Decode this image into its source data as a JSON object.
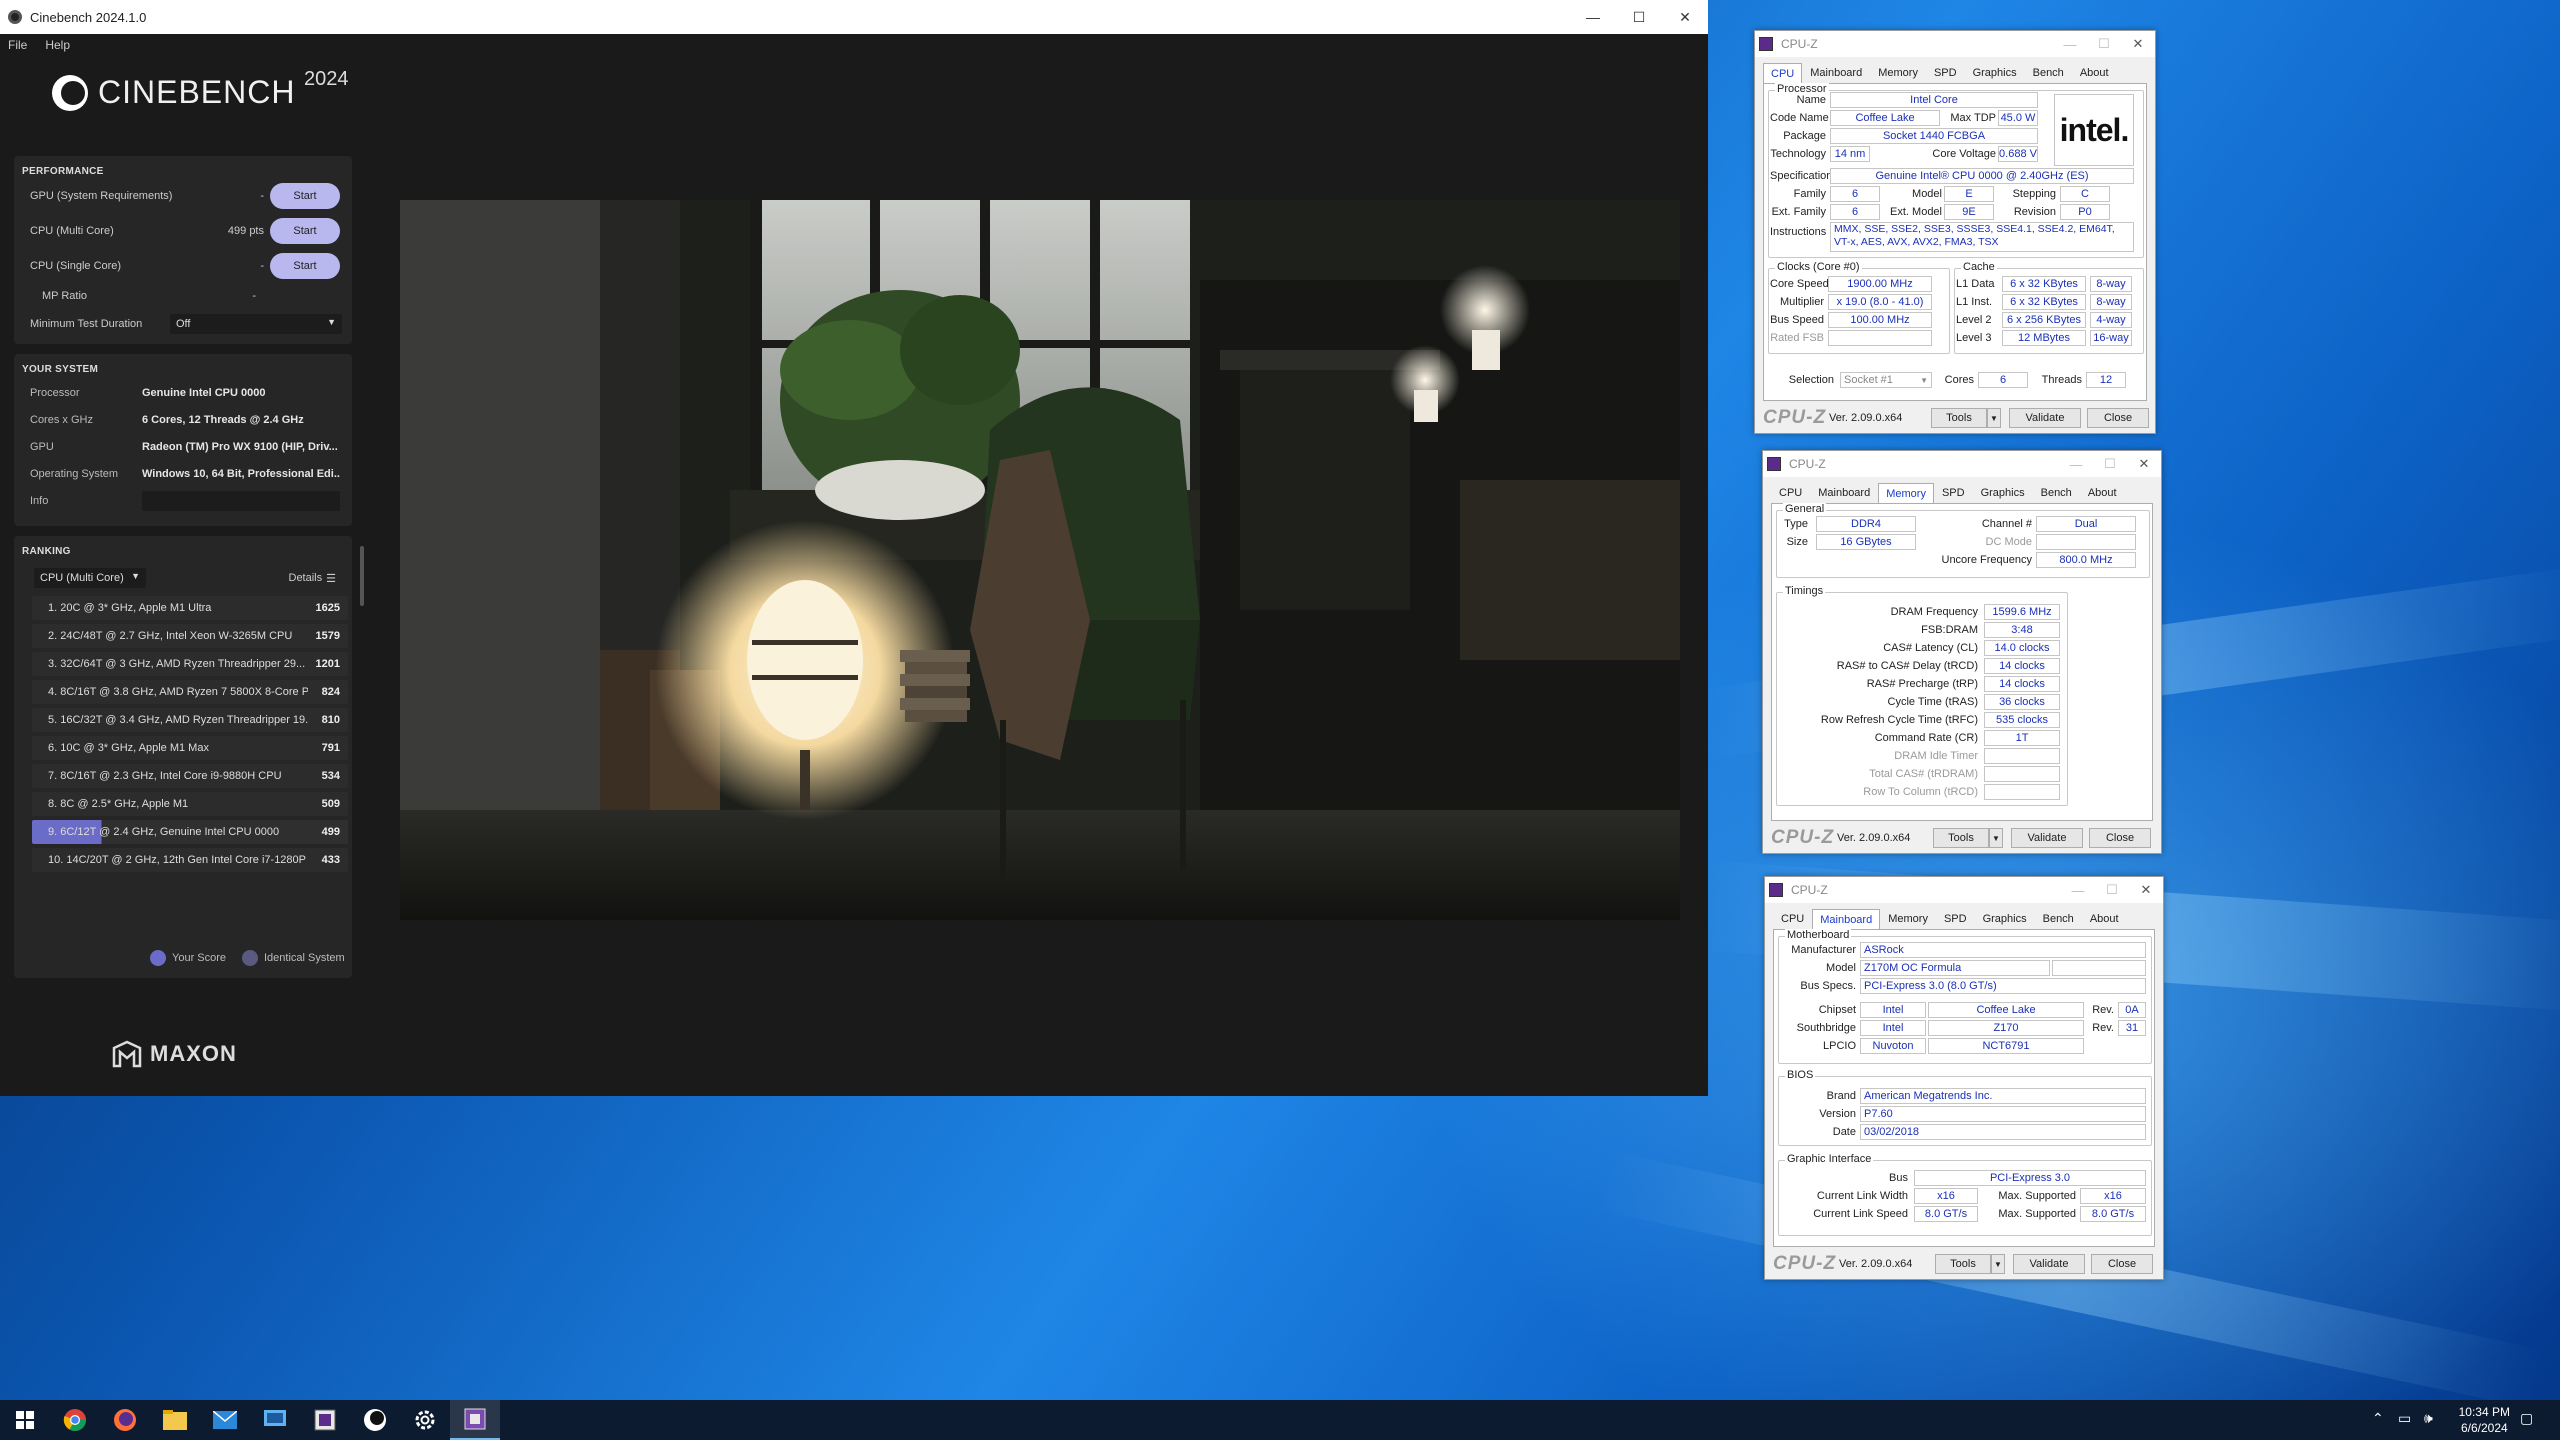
{
  "cinebench": {
    "window_title": "Cinebench 2024.1.0",
    "menu": [
      "File",
      "Help"
    ],
    "brand": "CINEBENCH",
    "year": "2024",
    "performance": {
      "header": "PERFORMANCE",
      "rows": [
        {
          "label": "GPU (System Requirements)",
          "points": "-",
          "button": "Start"
        },
        {
          "label": "CPU (Multi Core)",
          "points": "499 pts",
          "button": "Start"
        },
        {
          "label": "CPU (Single Core)",
          "points": "-",
          "button": "Start"
        }
      ],
      "mp_ratio_label": "MP Ratio",
      "mp_ratio_value": "-",
      "min_test_label": "Minimum Test Duration",
      "min_test_value": "Off"
    },
    "system": {
      "header": "YOUR SYSTEM",
      "rows": [
        {
          "key": "Processor",
          "value": "Genuine Intel CPU 0000"
        },
        {
          "key": "Cores x GHz",
          "value": "6 Cores, 12 Threads @ 2.4 GHz"
        },
        {
          "key": "GPU",
          "value": "Radeon (TM) Pro WX 9100 (HIP, Driv..."
        },
        {
          "key": "Operating System",
          "value": "Windows 10, 64 Bit, Professional Edi..."
        },
        {
          "key": "Info",
          "value": ""
        }
      ]
    },
    "ranking": {
      "header": "RANKING",
      "selector": "CPU (Multi Core)",
      "details": "Details",
      "rows": [
        {
          "name": "1. 20C @ 3* GHz, Apple M1 Ultra",
          "score": "1625",
          "mine": false
        },
        {
          "name": "2. 24C/48T @ 2.7 GHz, Intel Xeon W-3265M CPU",
          "score": "1579",
          "mine": false
        },
        {
          "name": "3. 32C/64T @ 3 GHz, AMD Ryzen Threadripper 29...",
          "score": "1201",
          "mine": false
        },
        {
          "name": "4. 8C/16T @ 3.8 GHz, AMD Ryzen 7 5800X 8-Core P...",
          "score": "824",
          "mine": false
        },
        {
          "name": "5. 16C/32T @ 3.4 GHz, AMD Ryzen Threadripper 19...",
          "score": "810",
          "mine": false
        },
        {
          "name": "6. 10C @ 3* GHz, Apple M1 Max",
          "score": "791",
          "mine": false
        },
        {
          "name": "7. 8C/16T @ 2.3 GHz, Intel Core i9-9880H CPU",
          "score": "534",
          "mine": false
        },
        {
          "name": "8. 8C @ 2.5* GHz, Apple M1",
          "score": "509",
          "mine": false
        },
        {
          "name": "9. 6C/12T @ 2.4 GHz, Genuine Intel CPU 0000",
          "score": "499",
          "mine": true
        },
        {
          "name": "10. 14C/20T @ 2 GHz, 12th Gen Intel Core i7-1280P",
          "score": "433",
          "mine": false
        }
      ],
      "legend_your": "Your Score",
      "legend_identical": "Identical System"
    },
    "maxon": "MAXON",
    "colors": {
      "accent": "#b8b8ef",
      "your_score": "#6b6bc8",
      "identical": "#5a5a80"
    }
  },
  "cpuz_cpu": {
    "title": "CPU-Z",
    "tabs": [
      "CPU",
      "Mainboard",
      "Memory",
      "SPD",
      "Graphics",
      "Bench",
      "About"
    ],
    "active_tab": "CPU",
    "processor_group": "Processor",
    "name_label": "Name",
    "name": "Intel Core",
    "code_name_label": "Code Name",
    "code_name": "Coffee Lake",
    "max_tdp_label": "Max TDP",
    "max_tdp": "45.0 W",
    "package_label": "Package",
    "package": "Socket 1440 FCBGA",
    "technology_label": "Technology",
    "technology": "14 nm",
    "core_voltage_label": "Core Voltage",
    "core_voltage": "0.688 V",
    "specification_label": "Specification",
    "specification": "Genuine Intel® CPU 0000 @ 2.40GHz (ES)",
    "family_label": "Family",
    "family": "6",
    "model_label": "Model",
    "model": "E",
    "stepping_label": "Stepping",
    "stepping": "C",
    "ext_family_label": "Ext. Family",
    "ext_family": "6",
    "ext_model_label": "Ext. Model",
    "ext_model": "9E",
    "revision_label": "Revision",
    "revision": "P0",
    "instructions_label": "Instructions",
    "instructions": "MMX, SSE, SSE2, SSE3, SSSE3, SSE4.1, SSE4.2, EM64T, VT-x, AES, AVX, AVX2, FMA3, TSX",
    "logo": "intel.",
    "clocks_group": "Clocks (Core #0)",
    "core_speed_label": "Core Speed",
    "core_speed": "1900.00 MHz",
    "multiplier_label": "Multiplier",
    "multiplier": "x 19.0 (8.0 - 41.0)",
    "bus_speed_label": "Bus Speed",
    "bus_speed": "100.00 MHz",
    "rated_fsb_label": "Rated FSB",
    "rated_fsb": "",
    "cache_group": "Cache",
    "cache": [
      {
        "label": "L1 Data",
        "size": "6 x 32 KBytes",
        "way": "8-way"
      },
      {
        "label": "L1 Inst.",
        "size": "6 x 32 KBytes",
        "way": "8-way"
      },
      {
        "label": "Level 2",
        "size": "6 x 256 KBytes",
        "way": "4-way"
      },
      {
        "label": "Level 3",
        "size": "12 MBytes",
        "way": "16-way"
      }
    ],
    "selection_label": "Selection",
    "selection": "Socket #1",
    "cores_label": "Cores",
    "cores": "6",
    "threads_label": "Threads",
    "threads": "12",
    "brand": "CPU-Z",
    "version": "Ver. 2.09.0.x64",
    "tools": "Tools",
    "validate": "Validate",
    "close": "Close"
  },
  "cpuz_mem": {
    "title": "CPU-Z",
    "tabs": [
      "CPU",
      "Mainboard",
      "Memory",
      "SPD",
      "Graphics",
      "Bench",
      "About"
    ],
    "active_tab": "Memory",
    "general_group": "General",
    "type_label": "Type",
    "type": "DDR4",
    "size_label": "Size",
    "size": "16 GBytes",
    "channel_label": "Channel #",
    "channel": "Dual",
    "dc_mode_label": "DC Mode",
    "dc_mode": "",
    "uncore_label": "Uncore Frequency",
    "uncore": "800.0 MHz",
    "timings_group": "Timings",
    "timings": [
      {
        "label": "DRAM Frequency",
        "value": "1599.6 MHz",
        "dim": false
      },
      {
        "label": "FSB:DRAM",
        "value": "3:48",
        "dim": false
      },
      {
        "label": "CAS# Latency (CL)",
        "value": "14.0 clocks",
        "dim": false
      },
      {
        "label": "RAS# to CAS# Delay (tRCD)",
        "value": "14 clocks",
        "dim": false
      },
      {
        "label": "RAS# Precharge (tRP)",
        "value": "14 clocks",
        "dim": false
      },
      {
        "label": "Cycle Time (tRAS)",
        "value": "36 clocks",
        "dim": false
      },
      {
        "label": "Row Refresh Cycle Time (tRFC)",
        "value": "535 clocks",
        "dim": false
      },
      {
        "label": "Command Rate (CR)",
        "value": "1T",
        "dim": false
      },
      {
        "label": "DRAM Idle Timer",
        "value": "",
        "dim": true
      },
      {
        "label": "Total CAS# (tRDRAM)",
        "value": "",
        "dim": true
      },
      {
        "label": "Row To Column (tRCD)",
        "value": "",
        "dim": true
      }
    ],
    "brand": "CPU-Z",
    "version": "Ver. 2.09.0.x64",
    "tools": "Tools",
    "validate": "Validate",
    "close": "Close"
  },
  "cpuz_mb": {
    "title": "CPU-Z",
    "tabs": [
      "CPU",
      "Mainboard",
      "Memory",
      "SPD",
      "Graphics",
      "Bench",
      "About"
    ],
    "active_tab": "Mainboard",
    "motherboard_group": "Motherboard",
    "manufacturer_label": "Manufacturer",
    "manufacturer": "ASRock",
    "model_label": "Model",
    "model": "Z170M OC Formula",
    "bus_specs_label": "Bus Specs.",
    "bus_specs": "PCI-Express 3.0 (8.0 GT/s)",
    "chipset_label": "Chipset",
    "chipset_vendor": "Intel",
    "chipset_name": "Coffee Lake",
    "chipset_rev_label": "Rev.",
    "chipset_rev": "0A",
    "southbridge_label": "Southbridge",
    "southbridge_vendor": "Intel",
    "southbridge_name": "Z170",
    "southbridge_rev_label": "Rev.",
    "southbridge_rev": "31",
    "lpcio_label": "LPCIO",
    "lpcio_vendor": "Nuvoton",
    "lpcio_name": "NCT6791",
    "bios_group": "BIOS",
    "brand_label": "Brand",
    "bios_brand": "American Megatrends Inc.",
    "version_label": "Version",
    "bios_version": "P7.60",
    "date_label": "Date",
    "bios_date": "03/02/2018",
    "graphic_group": "Graphic Interface",
    "bus_label": "Bus",
    "bus": "PCI-Express 3.0",
    "link_width_label": "Current Link Width",
    "link_width": "x16",
    "max_width_label": "Max. Supported",
    "max_width": "x16",
    "link_speed_label": "Current Link Speed",
    "link_speed": "8.0 GT/s",
    "max_speed_label": "Max. Supported",
    "max_speed": "8.0 GT/s",
    "brand": "CPU-Z",
    "version": "Ver. 2.09.0.x64",
    "tools": "Tools",
    "validate": "Validate",
    "close": "Close"
  },
  "taskbar": {
    "time": "10:34 PM",
    "date": "6/6/2024",
    "apps": [
      "windows-start-icon",
      "chrome-icon",
      "firefox-icon",
      "file-explorer-icon",
      "mail-icon",
      "app-icon",
      "cpu-z-taskbar-icon",
      "cinebench-taskbar-icon",
      "settings-icon",
      "cpu-z-active-icon"
    ]
  }
}
